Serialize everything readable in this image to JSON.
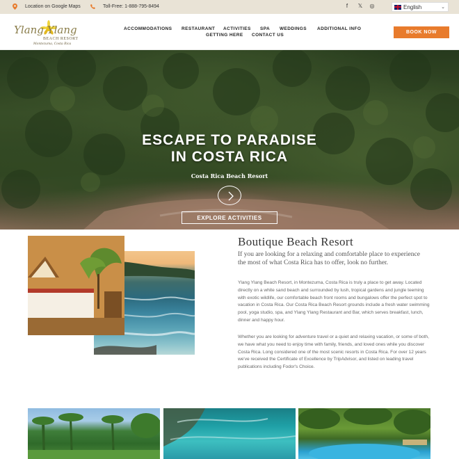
{
  "topbar": {
    "location_label": "Location on Google Maps",
    "phone_label": "Toll-Free: 1-888-795-8494",
    "social": [
      {
        "icon": "facebook-icon",
        "glyph": "f"
      },
      {
        "icon": "x-twitter-icon",
        "glyph": "𝕏"
      },
      {
        "icon": "instagram-icon",
        "glyph": "◎"
      }
    ],
    "language": "English",
    "accent_color": "#e87b2c"
  },
  "header": {
    "logo": {
      "line1": "Ylang Ylang",
      "line2": "BEACH RESORT",
      "line3": "Montezuma, Costa Rica"
    },
    "nav": [
      "ACCOMMODATIONS",
      "RESTAURANT",
      "ACTIVITIES",
      "SPA",
      "WEDDINGS",
      "ADDITIONAL INFO",
      "GETTING HERE",
      "CONTACT US"
    ],
    "book_label": "BOOK NOW",
    "book_color": "#e87b2c"
  },
  "hero": {
    "title_line1": "ESCAPE TO PARADISE",
    "title_line2": "IN COSTA RICA",
    "subtitle": "Costa Rica Beach Resort",
    "cta": "EXPLORE ACTIVITIES"
  },
  "intro": {
    "heading": "Boutique Beach Resort",
    "lead": "If you are looking for a relaxing and comfortable place to experience the most of what Costa Rica has to offer, look no further.",
    "para1": "Ylang Ylang Beach Resort, in Montezuma, Costa Rica is truly a place to get away. Located directly on a white sand beach and surrounded by lush, tropical gardens and jungle teeming with exotic wildlife, our comfortable beach front rooms and bungalows offer the perfect spot to vacation in Costa Rica. Our Costa Rica Beach Resort grounds include a fresh water swimming pool, yoga studio, spa, and Ylang Ylang Restaurant and Bar, which serves breakfast, lunch, dinner and happy hour.",
    "para2": "Whether you are looking for adventure travel or a quiet and relaxing vacation, or some of both, we have what you need to enjoy time with family, friends, and loved ones while you discover Costa Rica. Long considered one of the most scenic resorts in Costa Rica. For over 12 years we've received the Certificate of Excellence by TripAdvisor, and listed on leading travel publications including Fodor's Choice."
  }
}
